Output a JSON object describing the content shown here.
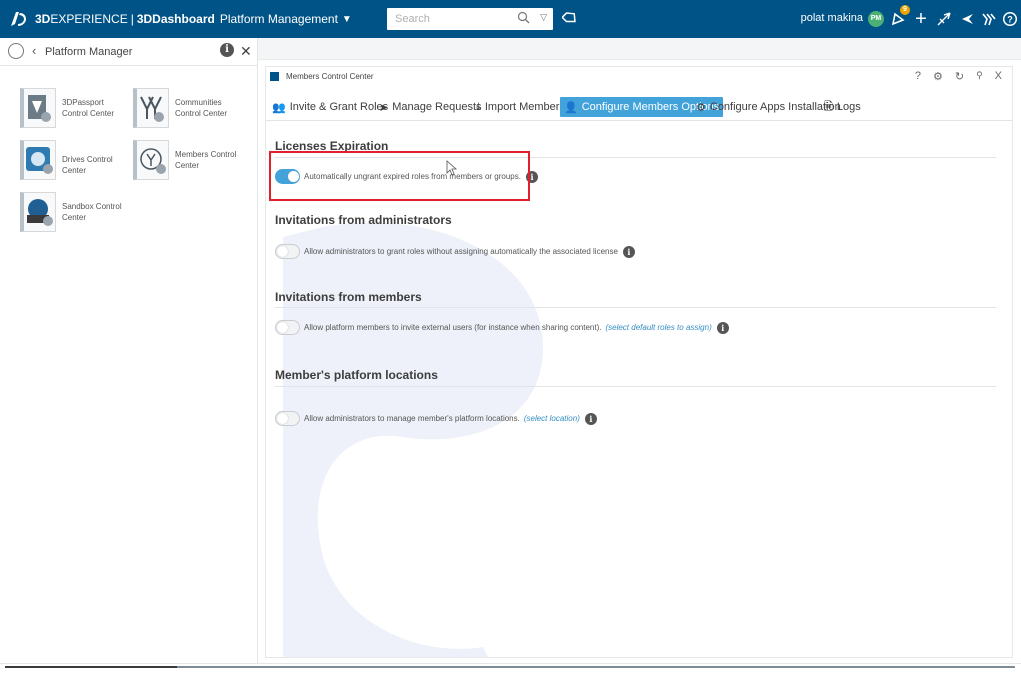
{
  "topbar": {
    "brand_bold": "3D",
    "brand_rest": "EXPERIENCE",
    "brand_separator": "|",
    "brand_app": "3DDashboard",
    "brand_context": "Platform Management",
    "search_placeholder": "Search",
    "user_name": "polat makina",
    "avatar_initials": "PM",
    "notification_count": "9",
    "bg_color": "#005386"
  },
  "left_panel": {
    "title": "Platform Manager",
    "apps": [
      {
        "label": "3DPassport Control Center"
      },
      {
        "label": "Communities Control Center"
      },
      {
        "label": "Drives Control Center"
      },
      {
        "label": "Members Control Center"
      },
      {
        "label": "Sandbox Control Center"
      }
    ]
  },
  "widget": {
    "title": "Members Control Center",
    "tools": [
      "?",
      "⚙",
      "↻",
      "📌",
      "X"
    ],
    "tabs": [
      {
        "label": "Invite & Grant Roles",
        "icon": "users-plus-icon"
      },
      {
        "label": "Manage Requests",
        "icon": "tag-arrow-icon"
      },
      {
        "label": "Import Members",
        "icon": "import-icon"
      },
      {
        "label": "Configure Members Options",
        "icon": "user-gear-icon",
        "active": true
      },
      {
        "label": "Configure Apps Installation",
        "icon": "gear-icon"
      },
      {
        "label": "Logs",
        "icon": "document-icon"
      }
    ],
    "accent_color": "#42a2da",
    "sections": [
      {
        "title": "Licenses Expiration",
        "option": "Automatically ungrant expired roles from members or groups.",
        "link": "",
        "enabled": true
      },
      {
        "title": "Invitations from administrators",
        "option": "Allow administrators to grant roles without assigning automatically the associated license",
        "link": "",
        "enabled": false
      },
      {
        "title": "Invitations from members",
        "option": "Allow platform members to invite external users (for instance when sharing content).",
        "link": "(select default roles to assign)",
        "enabled": false
      },
      {
        "title": "Member's platform locations",
        "option": "Allow administrators to manage member's platform locations.",
        "link": "(select location)",
        "enabled": false
      }
    ]
  }
}
